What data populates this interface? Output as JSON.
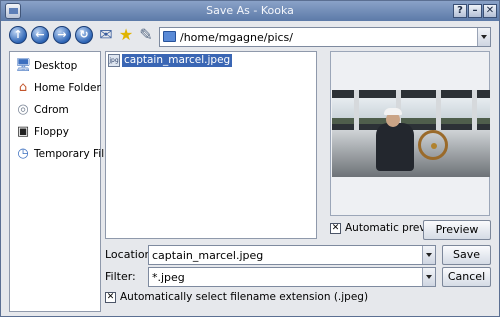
{
  "window": {
    "title": "Save As - Kooka",
    "controls": {
      "help": "?",
      "minimize": "–",
      "close": "✕"
    }
  },
  "toolbar": {
    "buttons": [
      "up-arrow-icon",
      "back-arrow-icon",
      "forward-arrow-icon",
      "reload-icon",
      "new-folder-icon",
      "bookmark-star-icon",
      "configure-wrench-icon"
    ],
    "path": "/home/mgagne/pics/"
  },
  "places": [
    {
      "label": "Desktop",
      "icon": "desktop-icon"
    },
    {
      "label": "Home Folder",
      "icon": "home-icon"
    },
    {
      "label": "Cdrom",
      "icon": "cdrom-icon"
    },
    {
      "label": "Floppy",
      "icon": "floppy-icon"
    },
    {
      "label": "Temporary Fil...",
      "icon": "temp-folder-icon"
    }
  ],
  "files": [
    {
      "name": "captain_marcel.jpeg",
      "selected": true
    }
  ],
  "preview": {
    "automatic_label": "Automatic preview",
    "automatic_checked": true,
    "preview_button": "Preview"
  },
  "form": {
    "location_label": "Location:",
    "location_value": "captain_marcel.jpeg",
    "filter_label": "Filter:",
    "filter_value": "*.jpeg",
    "save_button": "Save",
    "cancel_button": "Cancel",
    "auto_ext_label": "Automatically select filename extension (.jpeg)",
    "auto_ext_checked": true
  },
  "colors": {
    "titlebar": "#5c7aa8",
    "selection": "#3a66b4"
  }
}
